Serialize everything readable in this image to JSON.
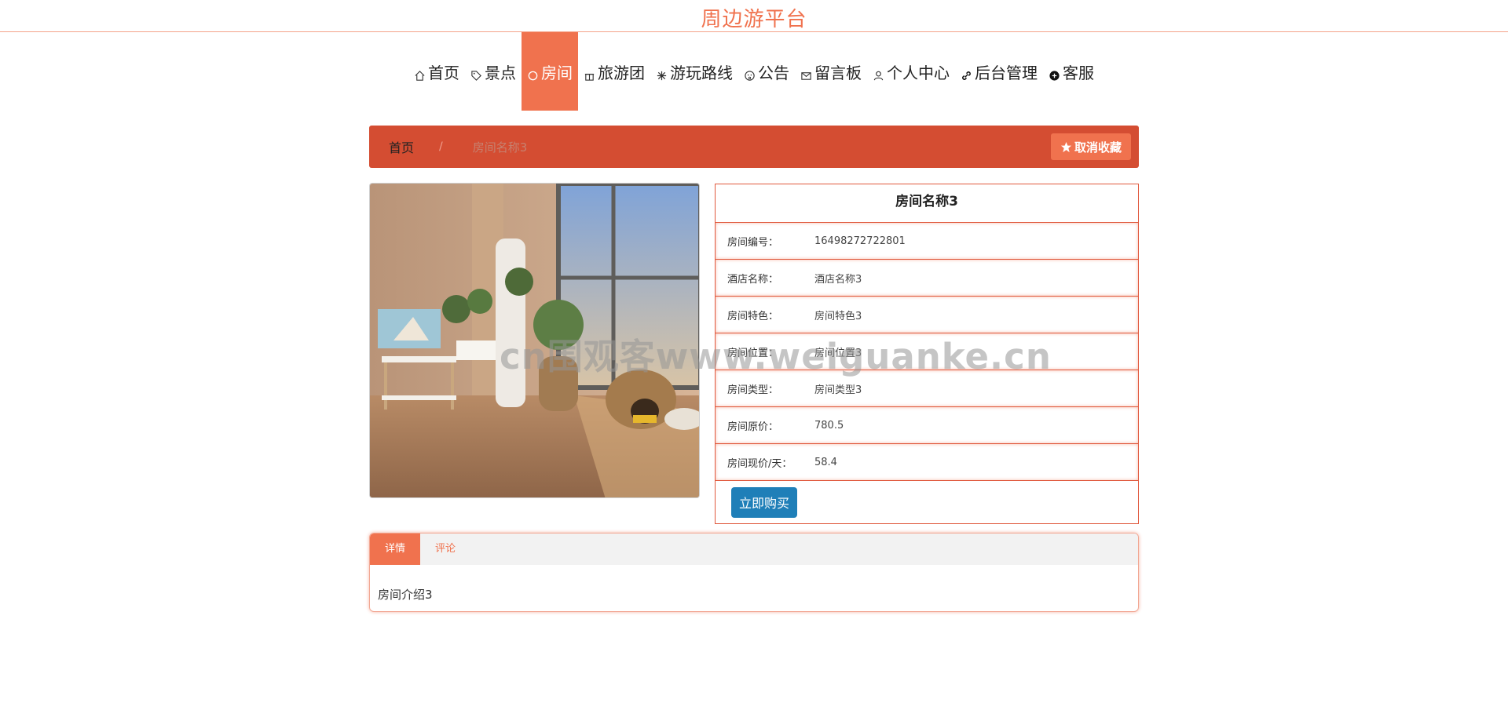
{
  "site": {
    "title": "周边游平台"
  },
  "nav": [
    {
      "label": "首页",
      "icon": "home-icon",
      "active": false
    },
    {
      "label": "景点",
      "icon": "tag-icon",
      "active": false
    },
    {
      "label": "房间",
      "icon": "circle-icon",
      "active": true
    },
    {
      "label": "旅游团",
      "icon": "gift-icon",
      "active": false
    },
    {
      "label": "游玩路线",
      "icon": "snowflake-icon",
      "active": false
    },
    {
      "label": "公告",
      "icon": "face-icon",
      "active": false
    },
    {
      "label": "留言板",
      "icon": "mail-icon",
      "active": false
    },
    {
      "label": "个人中心",
      "icon": "user-icon",
      "active": false
    },
    {
      "label": "后台管理",
      "icon": "link-icon",
      "active": false
    },
    {
      "label": "客服",
      "icon": "chat-icon",
      "active": false
    }
  ],
  "breadcrumb": {
    "home": "首页",
    "separator": "/",
    "current": "房间名称3"
  },
  "actions": {
    "unfavorite": "取消收藏",
    "buy": "立即购买"
  },
  "room": {
    "title": "房间名称3",
    "fields": [
      {
        "label": "房间编号：",
        "value": "16498272722801"
      },
      {
        "label": "酒店名称：",
        "value": "酒店名称3"
      },
      {
        "label": "房间特色：",
        "value": "房间特色3"
      },
      {
        "label": "房间位置：",
        "value": "房间位置3"
      },
      {
        "label": "房间类型：",
        "value": "房间类型3"
      },
      {
        "label": "房间原价：",
        "value": "780.5"
      },
      {
        "label": "房间现价/天：",
        "value": "58.4"
      }
    ]
  },
  "tabs": [
    {
      "label": "详情",
      "active": true
    },
    {
      "label": "评论",
      "active": false
    }
  ],
  "detail": {
    "text": "房间介绍3"
  },
  "watermark": "cn围观客www.weiguanke.cn",
  "colors": {
    "accent": "#f0724e",
    "crumb_bg": "#d44d32",
    "buy": "#1f7fb8"
  }
}
